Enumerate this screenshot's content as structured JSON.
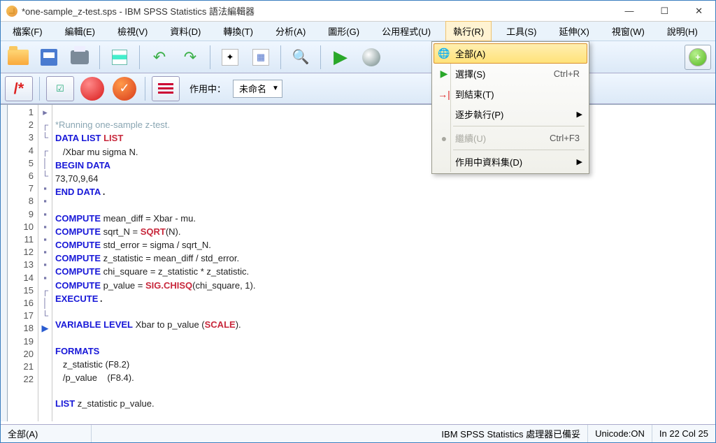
{
  "title": "*one-sample_z-test.sps - IBM SPSS Statistics 語法編輯器",
  "menubar": {
    "file": "檔案(F)",
    "edit": "編輯(E)",
    "view": "檢視(V)",
    "data": "資料(D)",
    "transform": "轉換(T)",
    "analyze": "分析(A)",
    "graphs": "圖形(G)",
    "utilities": "公用程式(U)",
    "run": "執行(R)",
    "tools": "工具(S)",
    "extensions": "延伸(X)",
    "window": "視窗(W)",
    "help": "說明(H)"
  },
  "toolbar2": {
    "active_label": "作用中：",
    "dataset": "未命名"
  },
  "dropdown": {
    "all": "全部(A)",
    "selection": "選擇(S)",
    "selection_key": "Ctrl+R",
    "to_end": "到結束(T)",
    "step": "逐步執行(P)",
    "continue": "繼續(U)",
    "continue_key": "Ctrl+F3",
    "active_dataset": "作用中資料集(D)"
  },
  "lines": [
    "1",
    "2",
    "3",
    "4",
    "5",
    "6",
    "7",
    "8",
    "9",
    "10",
    "11",
    "12",
    "13",
    "14",
    "15",
    "16",
    "17",
    "18",
    "19",
    "20",
    "21",
    "22"
  ],
  "code": {
    "l1": "*Running one-sample z-test.",
    "l2a": "DATA LIST",
    "l2b": " LIST",
    "l3": "   /Xbar mu sigma N.",
    "l4": "BEGIN DATA",
    "l5": "73,70,9,64",
    "l6": "END DATA",
    "l8a": "COMPUTE",
    "l8b": " mean_diff = Xbar - mu.",
    "l9a": "COMPUTE",
    "l9b": " sqrt_N = ",
    "l9c": "SQRT",
    "l9d": "(N).",
    "l10a": "COMPUTE",
    "l10b": " std_error = sigma / sqrt_N.",
    "l11a": "COMPUTE",
    "l11b": " z_statistic = mean_diff / std_error.",
    "l12a": "COMPUTE",
    "l12b": " chi_square = z_statistic * z_statistic.",
    "l13a": "COMPUTE",
    "l13b": " p_value = ",
    "l13c": "SIG.CHISQ",
    "l13d": "(chi_square, 1).",
    "l14": "EXECUTE",
    "l16a": "VARIABLE LEVEL",
    "l16b": " Xbar to p_value (",
    "l16c": "SCALE",
    "l16d": ").",
    "l18": "FORMATS",
    "l19": "   z_statistic (F8.2)",
    "l20": "   /p_value    (F8.4).",
    "l22a": "LIST",
    "l22b": " z_statistic p_value."
  },
  "status": {
    "left": "全部(A)",
    "processor": "IBM SPSS Statistics 處理器已備妥",
    "unicode": "Unicode:ON",
    "pos": "In 22 Col 25"
  }
}
